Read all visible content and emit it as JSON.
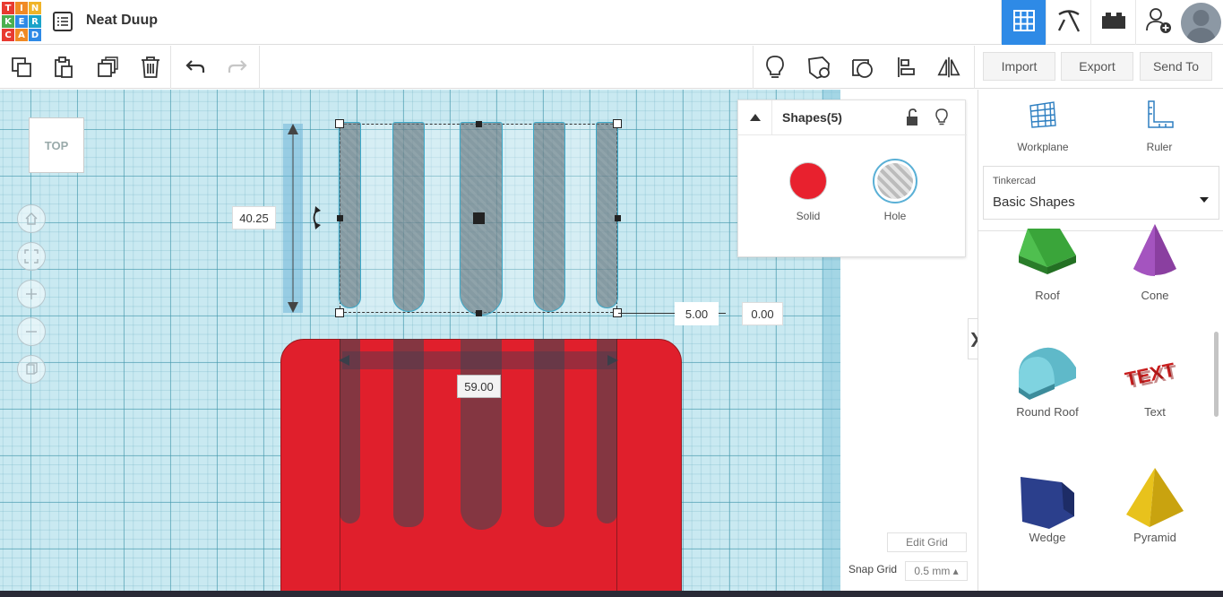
{
  "header": {
    "logo_letters": [
      "T",
      "I",
      "N",
      "K",
      "E",
      "R",
      "C",
      "A",
      "D"
    ],
    "logo_colors": [
      "#e83a30",
      "#f08a24",
      "#f0b429",
      "#4caf50",
      "#2e8ae6",
      "#1aa3c9",
      "#e83a30",
      "#f08a24",
      "#2e8ae6"
    ],
    "design_title": "Neat Duup",
    "right_buttons": [
      "grid-view-icon",
      "pickaxe-icon",
      "bricks-icon",
      "add-user-icon"
    ]
  },
  "toolbar": {
    "left_icons": [
      "copy-icon",
      "paste-icon",
      "duplicate-icon",
      "delete-icon",
      "undo-icon",
      "redo-icon"
    ],
    "right_icons": [
      "lightbulb-icon",
      "note-icon",
      "workplane-shape-icon",
      "align-icon",
      "mirror-icon"
    ],
    "import_label": "Import",
    "export_label": "Export",
    "send_to_label": "Send To"
  },
  "viewport": {
    "viewcube_label": "TOP",
    "nav_icons": [
      "home-icon",
      "fit-icon",
      "zoom-in-icon",
      "zoom-out-icon",
      "ortho-icon"
    ],
    "height_dim": "40.25",
    "offset_dim": "5.00",
    "elevation_dim": "0.00",
    "width_dim": "59.00"
  },
  "inspector": {
    "title": "Shapes(5)",
    "solid_label": "Solid",
    "hole_label": "Hole",
    "solid_color": "#e8212e"
  },
  "panel": {
    "workplane_label": "Workplane",
    "ruler_label": "Ruler",
    "library_source": "Tinkercad",
    "library_name": "Basic Shapes",
    "shapes": [
      {
        "label": "Roof"
      },
      {
        "label": "Cone"
      },
      {
        "label": "Round Roof"
      },
      {
        "label": "Text"
      },
      {
        "label": "Wedge"
      },
      {
        "label": "Pyramid"
      }
    ],
    "edit_grid_label": "Edit Grid",
    "snap_grid_label": "Snap Grid",
    "snap_grid_value": "0.5 mm ▴"
  }
}
